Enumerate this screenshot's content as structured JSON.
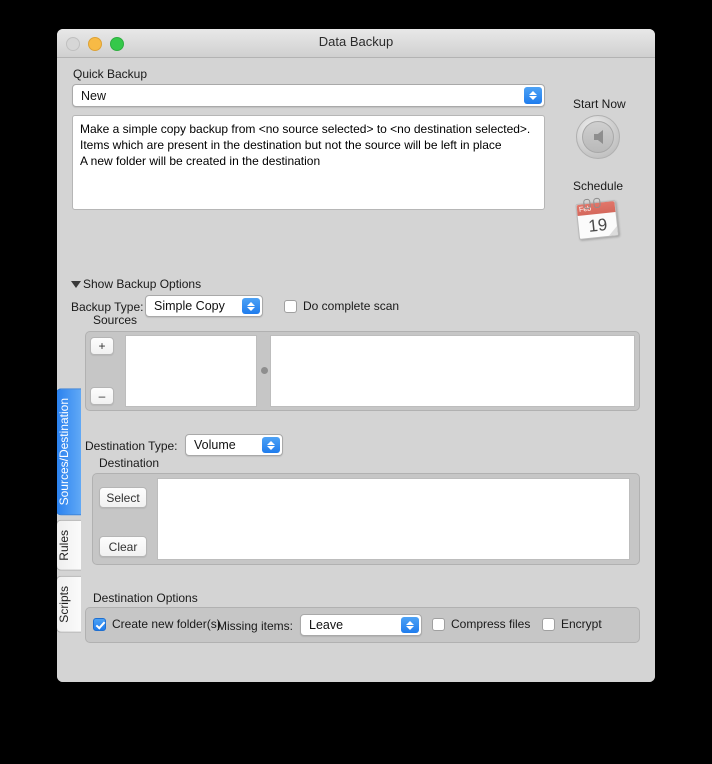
{
  "window": {
    "title": "Data Backup",
    "traffic_lights": [
      "close",
      "minimize",
      "maximize"
    ]
  },
  "quick_backup": {
    "label": "Quick Backup",
    "selected": "New",
    "description_lines": [
      "Make a simple copy backup from <no source selected> to <no destination selected>.",
      "Items which are present in the destination but not the source will be left in place",
      "A new folder will be created in the destination"
    ]
  },
  "actions": {
    "start_now_label": "Start Now",
    "schedule_label": "Schedule",
    "calendar_month": "Feb",
    "calendar_day": "19"
  },
  "options": {
    "disclosure_label": "Show Backup Options",
    "backup_type_label": "Backup Type:",
    "backup_type_value": "Simple Copy",
    "complete_scan_label": "Do complete scan",
    "complete_scan_checked": false
  },
  "sources": {
    "title": "Sources",
    "add_label": "+",
    "remove_label": "–",
    "left_items": [],
    "right_items": []
  },
  "destination": {
    "type_label": "Destination Type:",
    "type_value": "Volume",
    "title": "Destination",
    "select_label": "Select",
    "clear_label": "Clear",
    "path_value": ""
  },
  "destination_options": {
    "title": "Destination Options",
    "create_folders_label": "Create new folder(s)",
    "create_folders_checked": true,
    "missing_items_label": "Missing items:",
    "missing_items_value": "Leave",
    "compress_label": "Compress files",
    "compress_checked": false,
    "encrypt_label": "Encrypt",
    "encrypt_checked": false
  },
  "tabs": [
    {
      "label": "Sources/Destination",
      "active": true
    },
    {
      "label": "Rules",
      "active": false
    },
    {
      "label": "Scripts",
      "active": false
    }
  ],
  "colors": {
    "accent": "#2b82ef",
    "window_bg": "#d4d4d4",
    "group_bg": "#c6c6c6",
    "calendar_header": "#d4685c"
  }
}
